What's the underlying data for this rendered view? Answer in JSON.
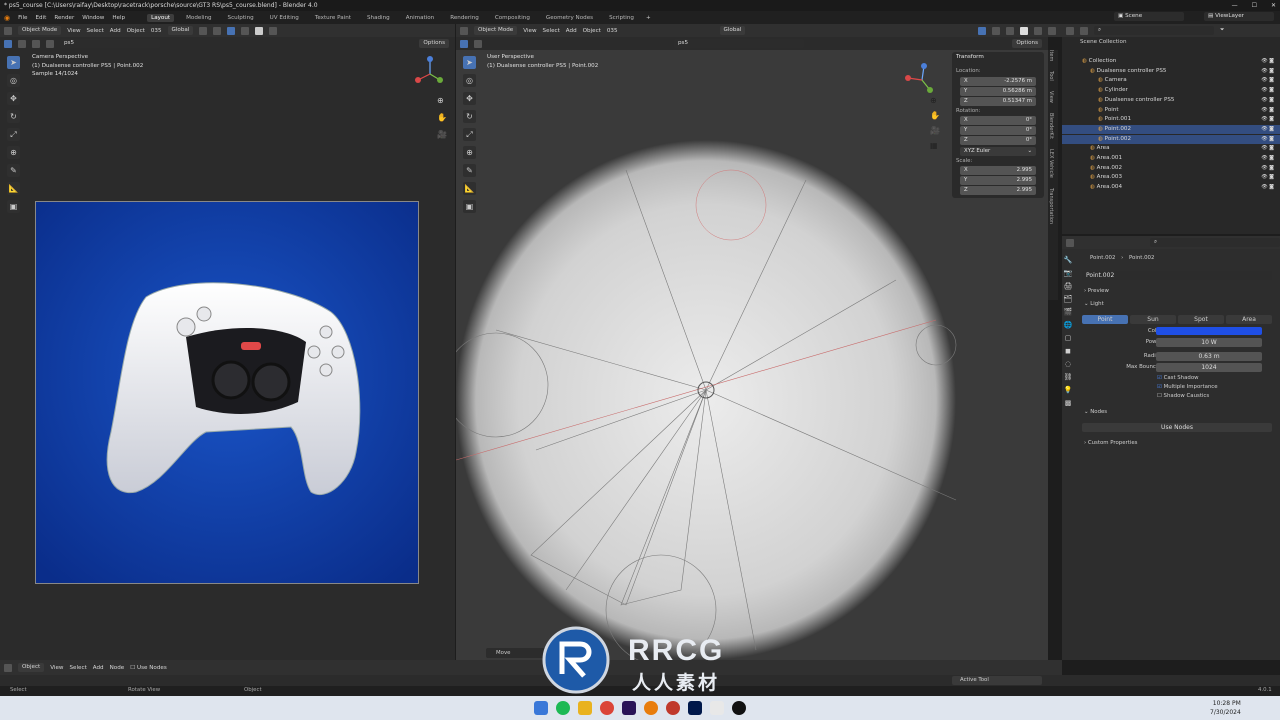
{
  "title": "* ps5_course [C:\\Users\\raifay\\Desktop\\racetrack\\porsche\\source\\GT3 RS\\ps5_course.blend] - Blender 4.0",
  "menu": [
    "File",
    "Edit",
    "Render",
    "Window",
    "Help"
  ],
  "workspaces": [
    "Layout",
    "Modeling",
    "Sculpting",
    "UV Editing",
    "Texture Paint",
    "Shading",
    "Animation",
    "Rendering",
    "Compositing",
    "Geometry Nodes",
    "Scripting"
  ],
  "scene": "Scene",
  "view_layer": "ViewLayer",
  "left_header": {
    "mode": "Object Mode",
    "view": "View",
    "select": "Select",
    "add": "Add",
    "object": "Object",
    "cam": "035",
    "orient": "Global",
    "search": "ps5",
    "options": "Options"
  },
  "right_header": {
    "mode": "Object Mode",
    "view": "View",
    "select": "Select",
    "add": "Add",
    "object": "Object",
    "cam": "035",
    "orient": "Global",
    "search": "ps5",
    "options": "Options"
  },
  "left_viewport": {
    "line1": "Camera Perspective",
    "line2": "(1) Dualsense controller PS5 | Point.002",
    "line3": "Sample 14/1024"
  },
  "right_viewport": {
    "line1": "User Perspective",
    "line2": "(1) Dualsense controller PS5 | Point.002"
  },
  "transform": {
    "title": "Transform",
    "location_label": "Location:",
    "location": [
      {
        "axis": "X",
        "value": "-2.2576 m"
      },
      {
        "axis": "Y",
        "value": "0.56286 m"
      },
      {
        "axis": "Z",
        "value": "0.51347 m"
      }
    ],
    "rotation_label": "Rotation:",
    "rotation": [
      {
        "axis": "X",
        "value": "0°"
      },
      {
        "axis": "Y",
        "value": "0°"
      },
      {
        "axis": "Z",
        "value": "0°"
      }
    ],
    "rotation_mode": "XYZ Euler",
    "scale_label": "Scale:",
    "scale": [
      {
        "axis": "X",
        "value": "2.995"
      },
      {
        "axis": "Y",
        "value": "2.995"
      },
      {
        "axis": "Z",
        "value": "2.995"
      }
    ]
  },
  "side_tabs": [
    "Item",
    "Tool",
    "View",
    "BlenderKit",
    "LEX Vehicle",
    "Transportation"
  ],
  "outliner": {
    "title": "Scene Collection",
    "rows": [
      {
        "name": "Collection",
        "indent": 1,
        "sel": false
      },
      {
        "name": "Dualsense controller PS5",
        "indent": 2,
        "sel": false
      },
      {
        "name": "Camera",
        "indent": 3,
        "sel": false
      },
      {
        "name": "Cylinder",
        "indent": 3,
        "sel": false
      },
      {
        "name": "Dualsense controller PS5",
        "indent": 3,
        "sel": false
      },
      {
        "name": "Point",
        "indent": 3,
        "sel": false
      },
      {
        "name": "Point.001",
        "indent": 3,
        "sel": false
      },
      {
        "name": "Point.002",
        "indent": 3,
        "sel": true
      },
      {
        "name": "Point.002",
        "indent": 3,
        "sel": true
      },
      {
        "name": "Area",
        "indent": 2,
        "sel": false
      },
      {
        "name": "Area.001",
        "indent": 2,
        "sel": false
      },
      {
        "name": "Area.002",
        "indent": 2,
        "sel": false
      },
      {
        "name": "Area.003",
        "indent": 2,
        "sel": false
      },
      {
        "name": "Area.004",
        "indent": 2,
        "sel": false
      }
    ]
  },
  "properties": {
    "breadcrumb_obj": "Point.002",
    "breadcrumb_data": "Point.002",
    "datablock": "Point.002",
    "preview": "Preview",
    "light": "Light",
    "light_types": [
      "Point",
      "Sun",
      "Spot",
      "Area"
    ],
    "color_label": "Color",
    "color_value": "#1f4fe6",
    "power_label": "Power",
    "power": "10 W",
    "radius_label": "Radius",
    "radius": "0.63 m",
    "bounces_label": "Max Bounces",
    "bounces": "1024",
    "cast_shadow": "Cast Shadow",
    "mis": "Multiple Importance",
    "caustics": "Shadow Caustics",
    "nodes": "Nodes",
    "use_nodes": "Use Nodes",
    "custom": "Custom Properties"
  },
  "bottom_header": {
    "mode": "Object",
    "view": "View",
    "select": "Select",
    "add": "Add",
    "node": "Node",
    "use_nodes": "Use Nodes"
  },
  "move_label": "Move",
  "active_tool": "Active Tool",
  "status": {
    "select": "Select",
    "rotate": "Rotate View",
    "object": "Object",
    "version": "4.0.1"
  },
  "watermark": {
    "big": "RRCG",
    "small": "人人素材"
  },
  "clock": {
    "time": "10:28 PM",
    "date": "7/30/2024"
  }
}
